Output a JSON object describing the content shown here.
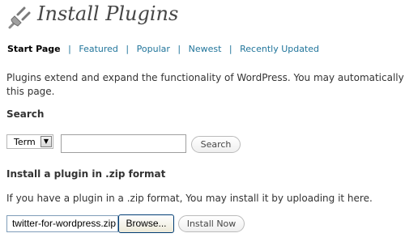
{
  "header": {
    "title": "Install Plugins",
    "icon": "plugin-plug-icon"
  },
  "subnav": {
    "current": "Start Page",
    "links": [
      "Featured",
      "Popular",
      "Newest",
      "Recently Updated"
    ],
    "separator": "|"
  },
  "intro": {
    "line1": "Plugins extend and expand the functionality of WordPress. You may automatically in",
    "line2": "this page."
  },
  "search": {
    "heading": "Search",
    "type_selected": "Term",
    "term_value": "",
    "button_label": "Search"
  },
  "zip": {
    "heading": "Install a plugin in .zip format",
    "description": "If you have a plugin in a .zip format, You may install it by uploading it here.",
    "file_value": "twitter-for-wordpress.zip",
    "browse_label": "Browse...",
    "install_label": "Install Now"
  },
  "colors": {
    "link": "#21759b",
    "text": "#333333",
    "title": "#464646"
  }
}
